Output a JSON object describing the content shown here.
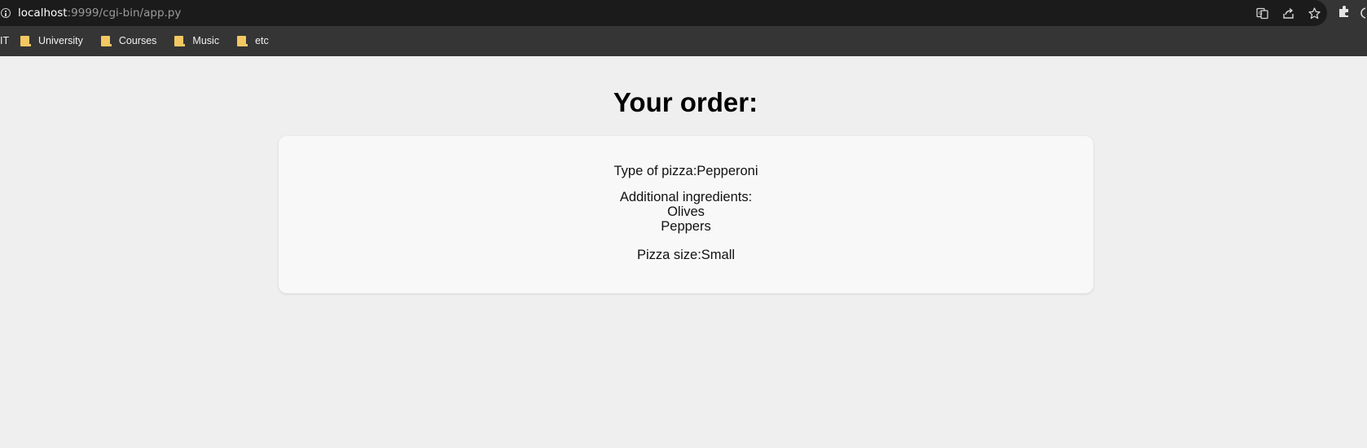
{
  "browser": {
    "url_host": "localhost",
    "url_rest": ":9999/cgi-bin/app.py",
    "toolbar_icons": [
      "translate-icon",
      "share-icon",
      "star-icon"
    ],
    "extensions_icon": "puzzle-icon"
  },
  "bookmarks": {
    "cut_label": "IT",
    "items": [
      {
        "label": "University",
        "icon": "folder-icon"
      },
      {
        "label": "Courses",
        "icon": "folder-icon"
      },
      {
        "label": "Music",
        "icon": "folder-icon"
      },
      {
        "label": "etc",
        "icon": "folder-icon"
      }
    ]
  },
  "page": {
    "title": "Your order:",
    "type_label": "Type of pizza:",
    "type_value": "Pepperoni",
    "ingredients_label": "Additional ingredients:",
    "ingredients": [
      "Olives",
      "Peppers"
    ],
    "size_label": "Pizza size:",
    "size_value": "Small"
  },
  "colors": {
    "page_background": "#efefef",
    "card_background": "#f8f8f8",
    "browser_chrome": "#353535",
    "address_bar": "#1b1b1b",
    "folder": "#f3c863"
  }
}
